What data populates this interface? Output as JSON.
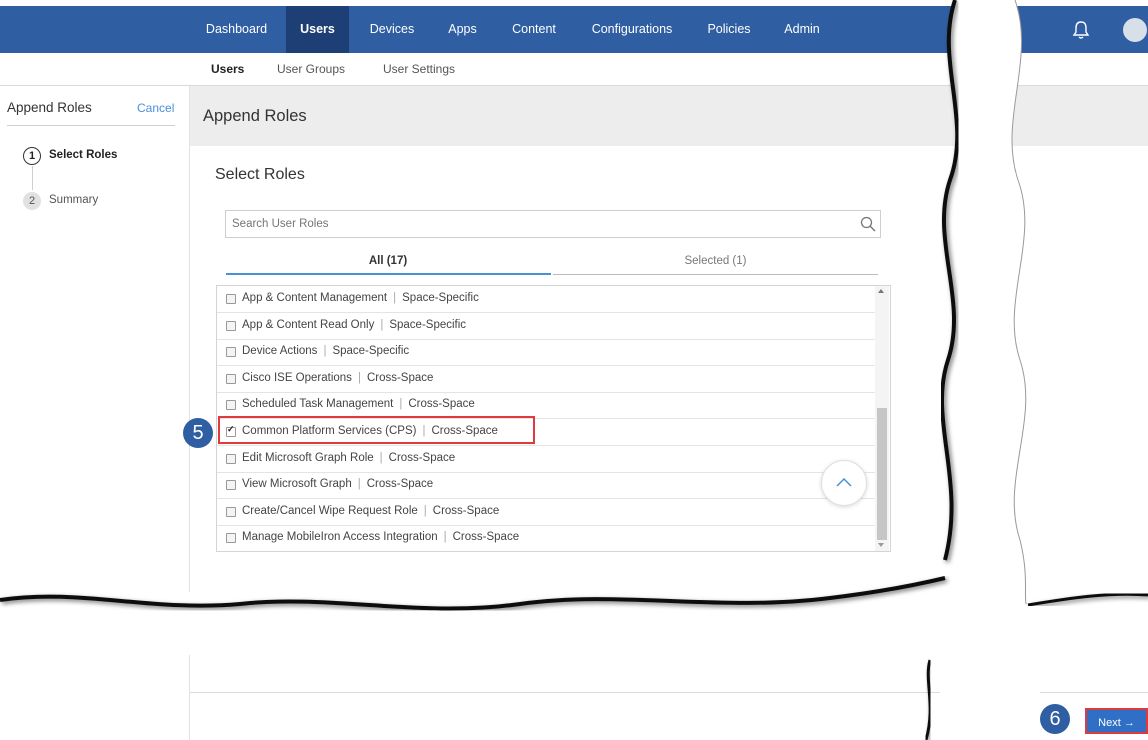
{
  "nav": {
    "items": [
      {
        "label": "Dashboard",
        "active": false
      },
      {
        "label": "Users",
        "active": true
      },
      {
        "label": "Devices",
        "active": false
      },
      {
        "label": "Apps",
        "active": false
      },
      {
        "label": "Content",
        "active": false
      },
      {
        "label": "Configurations",
        "active": false
      },
      {
        "label": "Policies",
        "active": false
      },
      {
        "label": "Admin",
        "active": false
      }
    ]
  },
  "subnav": {
    "items": [
      {
        "label": "Users",
        "active": true
      },
      {
        "label": "User Groups",
        "active": false
      },
      {
        "label": "User Settings",
        "active": false
      }
    ]
  },
  "wizard": {
    "title": "Append Roles",
    "cancel": "Cancel",
    "steps": [
      {
        "number": "1",
        "label": "Select Roles",
        "active": true
      },
      {
        "number": "2",
        "label": "Summary",
        "active": false
      }
    ]
  },
  "main": {
    "title": "Append Roles",
    "section_title": "Select Roles",
    "search_placeholder": "Search User Roles",
    "tabs": [
      {
        "label": "All (17)",
        "active": true
      },
      {
        "label": "Selected (1)",
        "active": false
      }
    ]
  },
  "roles": [
    {
      "name": "App & Content Management",
      "scope": "Space-Specific",
      "checked": false
    },
    {
      "name": "App & Content Read Only",
      "scope": "Space-Specific",
      "checked": false
    },
    {
      "name": "Device Actions",
      "scope": "Space-Specific",
      "checked": false
    },
    {
      "name": "Cisco ISE Operations",
      "scope": "Cross-Space",
      "checked": false
    },
    {
      "name": "Scheduled Task Management",
      "scope": "Cross-Space",
      "checked": false
    },
    {
      "name": "Common Platform Services (CPS)",
      "scope": "Cross-Space",
      "checked": true
    },
    {
      "name": "Edit Microsoft Graph Role",
      "scope": "Cross-Space",
      "checked": false
    },
    {
      "name": "View Microsoft Graph",
      "scope": "Cross-Space",
      "checked": false
    },
    {
      "name": "Create/Cancel Wipe Request Role",
      "scope": "Cross-Space",
      "checked": false
    },
    {
      "name": "Manage MobileIron Access Integration",
      "scope": "Cross-Space",
      "checked": false
    }
  ],
  "callouts": {
    "first": "5",
    "second": "6"
  },
  "footer": {
    "next_label": "Next →"
  },
  "colors": {
    "nav": "#2f5ea3",
    "accent": "#4a90d9",
    "highlight": "#e0393e"
  }
}
